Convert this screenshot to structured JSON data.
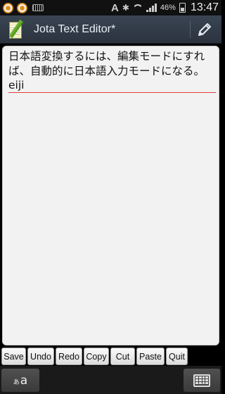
{
  "status_bar": {
    "time": "13:47",
    "battery_percent": "46%",
    "signal_letter": "A",
    "bluetooth_glyph": "✱",
    "icons": [
      "notification-circle-icon",
      "notification-circle-icon",
      "keyboard-icon",
      "bluetooth-icon",
      "wifi-icon",
      "signal-icon",
      "battery-icon"
    ]
  },
  "action_bar": {
    "title": "Jota Text Editor*",
    "app_icon": "notepad-icon",
    "edit_icon": "pencil-icon"
  },
  "editor": {
    "lines": [
      "日本語変換するには、編集モードにすれ",
      "ば、自動的に日本語入力モードになる。"
    ],
    "composing_text": "eiji"
  },
  "toolbar": {
    "buttons": [
      "Save",
      "Undo",
      "Redo",
      "Copy",
      "Cut",
      "Paste",
      "Quit"
    ]
  },
  "ime_bar": {
    "mode_small": "あ",
    "mode_big": "a",
    "keyboard_icon": "keyboard-grid-icon"
  },
  "colors": {
    "action_bar": "#333c47",
    "editor_bg": "#f2f2f2",
    "composing_underline": "#e04040"
  }
}
